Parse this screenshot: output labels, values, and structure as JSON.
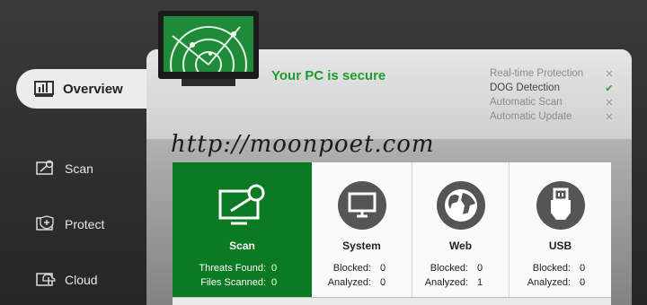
{
  "sidebar": {
    "items": [
      {
        "label": "Overview",
        "icon": "overview-icon"
      },
      {
        "label": "Scan",
        "icon": "scan-icon"
      },
      {
        "label": "Protect",
        "icon": "shield-plus-icon"
      },
      {
        "label": "Cloud",
        "icon": "cloud-upload-icon"
      }
    ]
  },
  "status": {
    "title": "Your PC is secure",
    "accent": "#1f9b2c"
  },
  "protection": [
    {
      "label": "Real-time Protection",
      "state": "x"
    },
    {
      "label": "DOG Detection",
      "state": "ok"
    },
    {
      "label": "Automatic Scan",
      "state": "x"
    },
    {
      "label": "Automatic Update",
      "state": "x"
    }
  ],
  "watermark": "http://moonpoet.com",
  "cards": {
    "scan": {
      "title": "Scan",
      "rows": [
        {
          "key": "Threats Found:",
          "value": "0"
        },
        {
          "key": "Files Scanned:",
          "value": "0"
        }
      ]
    },
    "system": {
      "title": "System",
      "rows": [
        {
          "key": "Blocked:",
          "value": "0"
        },
        {
          "key": "Analyzed:",
          "value": "0"
        }
      ]
    },
    "web": {
      "title": "Web",
      "rows": [
        {
          "key": "Blocked:",
          "value": "0"
        },
        {
          "key": "Analyzed:",
          "value": "1"
        }
      ]
    },
    "usb": {
      "title": "USB",
      "rows": [
        {
          "key": "Blocked:",
          "value": "0"
        },
        {
          "key": "Analyzed:",
          "value": "0"
        }
      ]
    }
  }
}
